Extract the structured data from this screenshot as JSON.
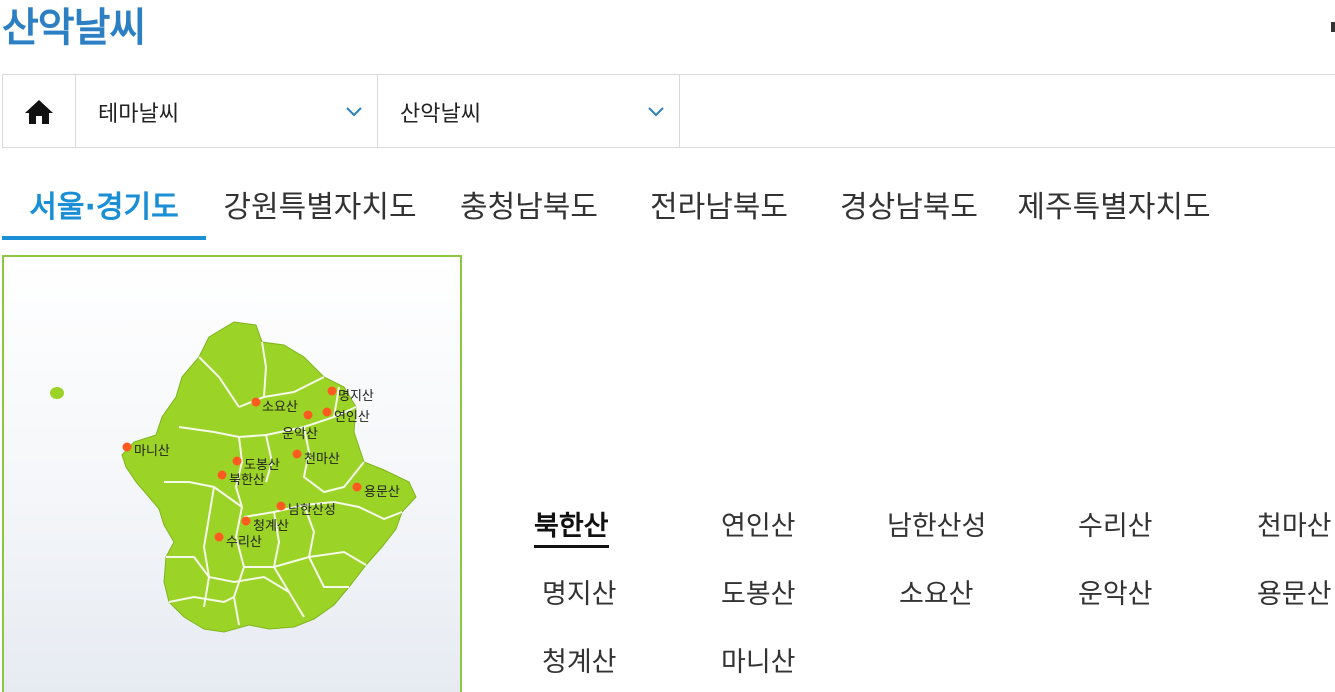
{
  "header": {
    "title": "산악날씨"
  },
  "nav": {
    "home_icon": "home-icon",
    "selects": [
      {
        "label": "테마날씨",
        "icon": "chevron-down-icon"
      },
      {
        "label": "산악날씨",
        "icon": "chevron-down-icon"
      }
    ]
  },
  "tabs": [
    {
      "label": "서울·경기도",
      "active": true
    },
    {
      "label": "강원특별자치도",
      "active": false
    },
    {
      "label": "충청남북도",
      "active": false
    },
    {
      "label": "전라남북도",
      "active": false
    },
    {
      "label": "경상남북도",
      "active": false
    },
    {
      "label": "제주특별자치도",
      "active": false
    }
  ],
  "map": {
    "labels": [
      "명지산",
      "소요산",
      "연인산",
      "운악산",
      "마니산",
      "천마산",
      "도봉산",
      "북한산",
      "용문산",
      "남한산성",
      "청계산",
      "수리산"
    ]
  },
  "mountains": {
    "selected": "북한산",
    "items": [
      "북한산",
      "연인산",
      "남한산성",
      "수리산",
      "천마산",
      "명지산",
      "도봉산",
      "소요산",
      "운악산",
      "용문산",
      "청계산",
      "마니산"
    ]
  },
  "colors": {
    "accent": "#1a8fd6",
    "title": "#2d7fc4",
    "map_fill": "#9cd327",
    "map_border": "#8dc63f",
    "marker": "#ff5a1f"
  }
}
